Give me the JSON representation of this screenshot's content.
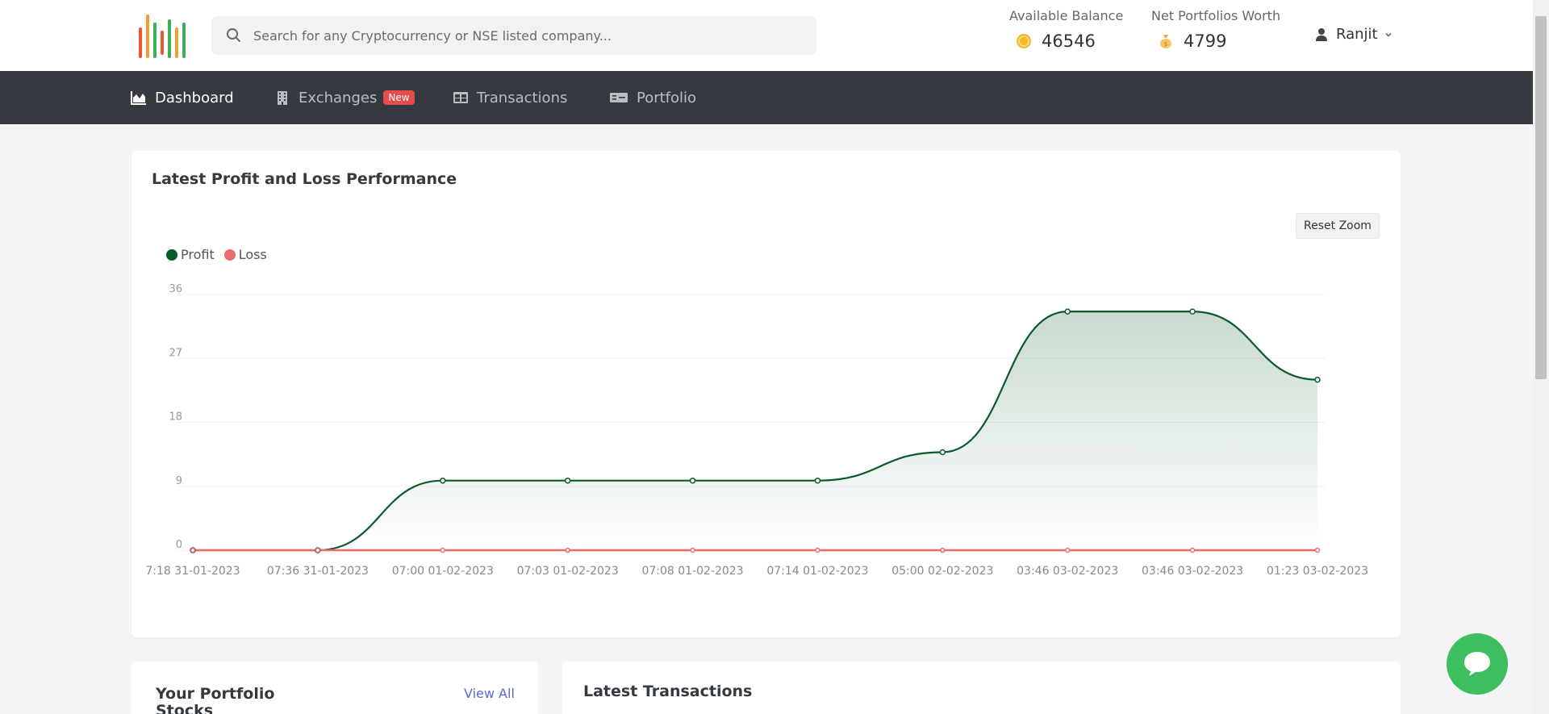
{
  "header": {
    "search_placeholder": "Search for any Cryptocurrency or NSE listed company...",
    "available_balance_label": "Available Balance",
    "available_balance_value": "46546",
    "net_worth_label": "Net Portfolios Worth",
    "net_worth_value": "4799",
    "user_name": "Ranjit"
  },
  "nav": {
    "items": [
      {
        "label": "Dashboard",
        "icon": "area-chart-icon",
        "active": true
      },
      {
        "label": "Exchanges",
        "icon": "building-icon",
        "badge": "New"
      },
      {
        "label": "Transactions",
        "icon": "table-icon"
      },
      {
        "label": "Portfolio",
        "icon": "money-bill-icon"
      }
    ]
  },
  "chart_card": {
    "title": "Latest Profit and Loss Performance",
    "reset_zoom_label": "Reset Zoom"
  },
  "chart_data": {
    "type": "area",
    "categories": [
      "07:18 31-01-2023",
      "07:36 31-01-2023",
      "07:00 01-02-2023",
      "07:03 01-02-2023",
      "07:08 01-02-2023",
      "07:14 01-02-2023",
      "05:00 02-02-2023",
      "03:46 03-02-2023",
      "03:46 03-02-2023",
      "01:23 03-02-2023"
    ],
    "tick_labels": [
      "7:18 31-01-2023",
      "07:36 31-01-2023",
      "07:00 01-02-2023",
      "07:03 01-02-2023",
      "07:08 01-02-2023",
      "07:14 01-02-2023",
      "05:00 02-02-2023",
      "03:46 03-02-2023",
      "03:46 03-02-2023",
      "01:23 03-02-2023"
    ],
    "series": [
      {
        "name": "Profit",
        "color": "#0a5a2a",
        "values": [
          0,
          0,
          9.8,
          9.8,
          9.8,
          9.8,
          13.8,
          33.6,
          33.6,
          24
        ]
      },
      {
        "name": "Loss",
        "color": "#ee6b6b",
        "values": [
          0,
          0,
          0,
          0,
          0,
          0,
          0,
          0,
          0,
          0
        ]
      }
    ],
    "ylim": [
      0,
      36
    ],
    "yticks": [
      0,
      9,
      18,
      27,
      36
    ],
    "grid": true,
    "legend": "top-left"
  },
  "portfolio_card": {
    "title": "Your Portfolio Stocks",
    "view_all_label": "View All"
  },
  "transactions_card": {
    "title": "Latest Transactions"
  }
}
